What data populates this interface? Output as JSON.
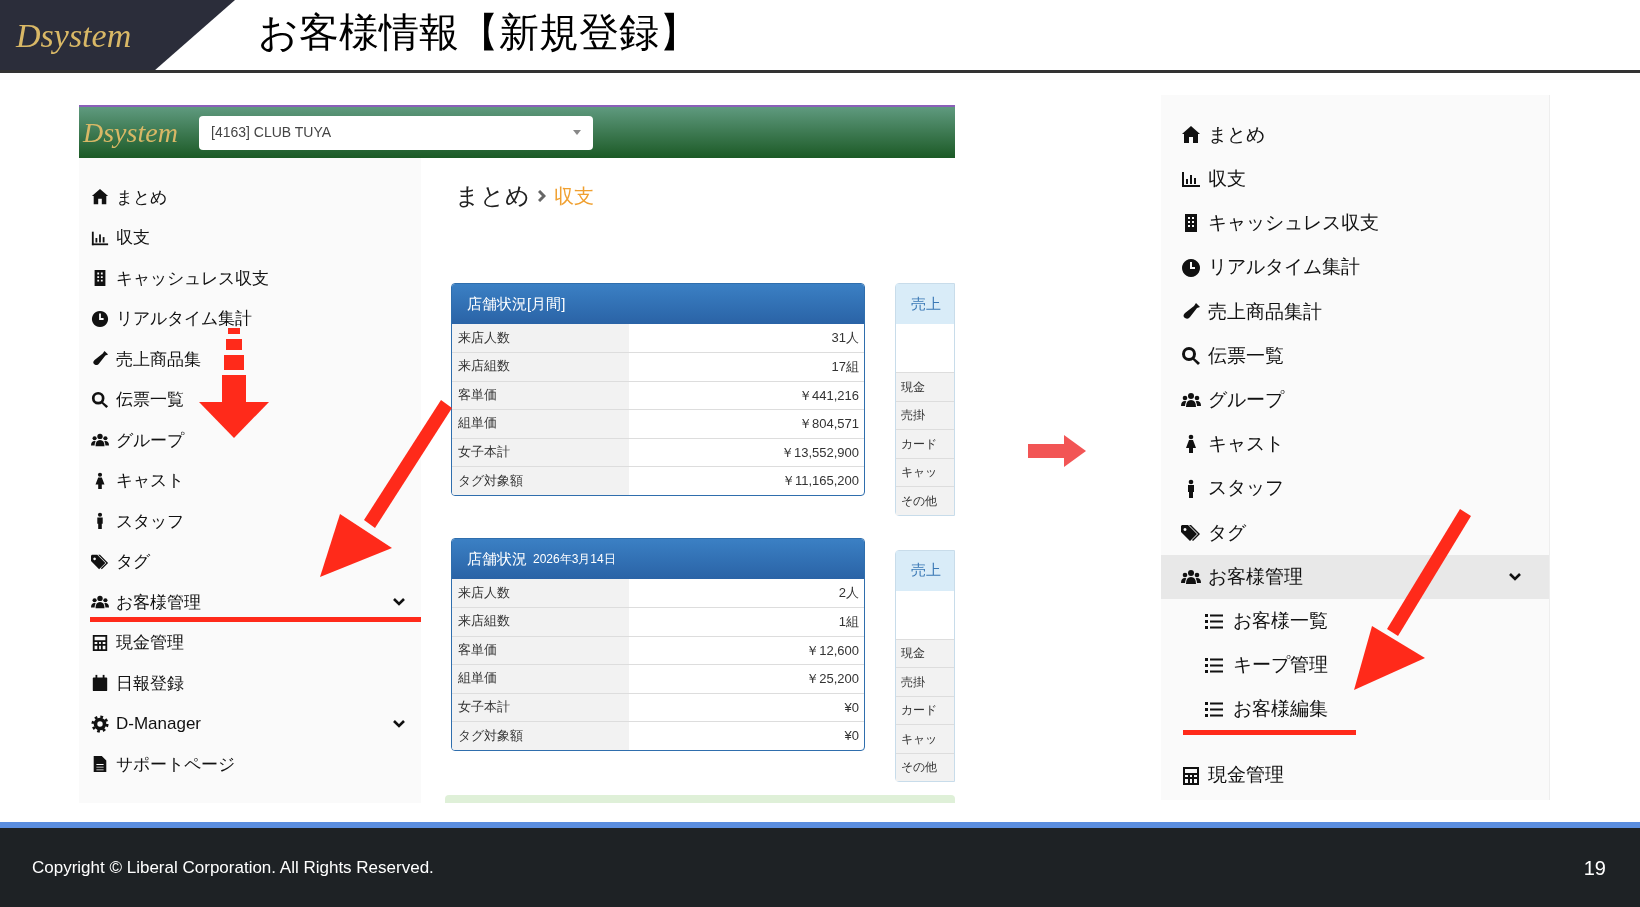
{
  "slide": {
    "logo": "Dsystem",
    "title": "お客様情報【新規登録】"
  },
  "left_screenshot": {
    "logo": "Dsystem",
    "store_select": {
      "value": "[4163] CLUB TUYA"
    },
    "sidebar": {
      "items": [
        {
          "label": "まとめ",
          "kind": "link"
        },
        {
          "label": "収支",
          "kind": "link"
        },
        {
          "label": "キャッシュレス収支",
          "kind": "link"
        },
        {
          "label": "リアルタイム集計",
          "kind": "link"
        },
        {
          "label": "売上商品集",
          "kind": "link"
        },
        {
          "label": "伝票一覧",
          "kind": "link"
        },
        {
          "label": "グループ",
          "kind": "link"
        },
        {
          "label": "キャスト",
          "kind": "link"
        },
        {
          "label": "スタッフ",
          "kind": "link"
        },
        {
          "label": "タグ",
          "kind": "link"
        },
        {
          "label": "お客様管理",
          "kind": "group"
        },
        {
          "label": "現金管理",
          "kind": "link"
        },
        {
          "label": "日報登録",
          "kind": "link"
        },
        {
          "label": "D-Manager",
          "kind": "group"
        },
        {
          "label": "サポートページ",
          "kind": "link"
        }
      ]
    },
    "breadcrumb": [
      "まとめ",
      "収支"
    ],
    "cards": [
      {
        "title": "店舗状況[月間]",
        "rows": [
          {
            "label": "来店人数",
            "value": "31人"
          },
          {
            "label": "来店組数",
            "value": "17組"
          },
          {
            "label": "客単価",
            "value": "￥441,216"
          },
          {
            "label": "組単価",
            "value": "￥804,571"
          },
          {
            "label": "女子本計",
            "value": "￥13,552,900"
          },
          {
            "label": "タグ対象額",
            "value": "￥11,165,200"
          }
        ]
      },
      {
        "title": "店舗状況",
        "subtitle": "2026年3月14日",
        "rows": [
          {
            "label": "来店人数",
            "value": "2人"
          },
          {
            "label": "来店組数",
            "value": "1組"
          },
          {
            "label": "客単価",
            "value": "￥12,600"
          },
          {
            "label": "組単価",
            "value": "￥25,200"
          },
          {
            "label": "女子本計",
            "value": "¥0"
          },
          {
            "label": "タグ対象額",
            "value": "¥0"
          }
        ]
      }
    ],
    "side_cards": [
      {
        "title": "売上",
        "rows": [
          "現金",
          "売掛",
          "カード",
          "キャッ",
          "その他"
        ]
      },
      {
        "title": "売上",
        "rows": [
          "現金",
          "売掛",
          "カード",
          "キャッ",
          "その他"
        ]
      }
    ]
  },
  "right_screenshot": {
    "sidebar": {
      "items": [
        {
          "label": "まとめ",
          "kind": "link",
          "selected": false
        },
        {
          "label": "収支",
          "kind": "link",
          "selected": false
        },
        {
          "label": "キャッシュレス収支",
          "kind": "link",
          "selected": false
        },
        {
          "label": "リアルタイム集計",
          "kind": "link",
          "selected": false
        },
        {
          "label": "売上商品集計",
          "kind": "link",
          "selected": false
        },
        {
          "label": "伝票一覧",
          "kind": "link",
          "selected": false
        },
        {
          "label": "グループ",
          "kind": "link",
          "selected": false
        },
        {
          "label": "キャスト",
          "kind": "link",
          "selected": false
        },
        {
          "label": "スタッフ",
          "kind": "link",
          "selected": false
        },
        {
          "label": "タグ",
          "kind": "link",
          "selected": false
        },
        {
          "label": "お客様管理",
          "kind": "group",
          "selected": true,
          "children": [
            {
              "label": "お客様一覧"
            },
            {
              "label": "キープ管理"
            },
            {
              "label": "お客様編集"
            }
          ]
        },
        {
          "label": "現金管理",
          "kind": "link",
          "selected": false
        }
      ]
    }
  },
  "footer": {
    "copyright": "Copyright ©  Liberal Corporation. All Rights Reserved.",
    "page_number": "19"
  }
}
